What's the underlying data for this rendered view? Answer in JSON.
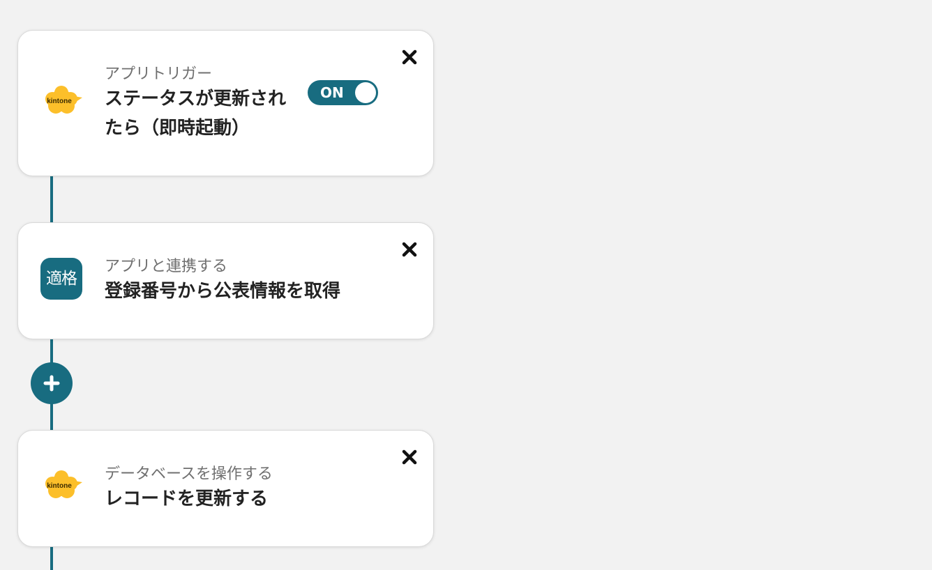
{
  "accent_color": "#186c80",
  "steps": [
    {
      "icon": "kintone-logo-icon",
      "logo_text": "kintone",
      "subtitle": "アプリトリガー",
      "title_line1": "ステータスが更新され",
      "title_line2": "たら（即時起動）",
      "toggle": {
        "label": "ON",
        "state": "on"
      }
    },
    {
      "icon": "app-icon",
      "icon_text": "適格",
      "subtitle": "アプリと連携する",
      "title": "登録番号から公表情報を取得"
    },
    {
      "icon": "kintone-logo-icon",
      "logo_text": "kintone",
      "subtitle": "データベースを操作する",
      "title": "レコードを更新する"
    }
  ],
  "add_step_icon": "plus-icon",
  "close_icon": "close-icon"
}
